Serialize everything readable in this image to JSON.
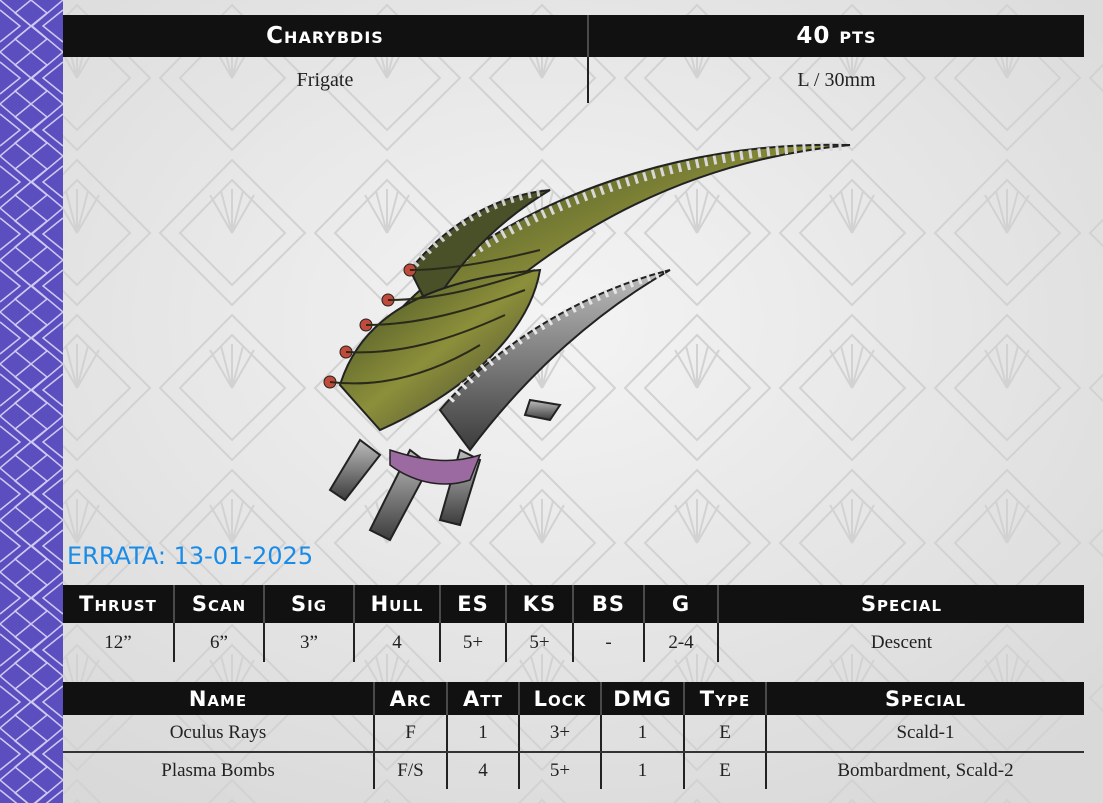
{
  "card": {
    "name": "Charybdis",
    "points": "40 pts",
    "class": "Frigate",
    "base": "L / 30mm"
  },
  "errata": "ERRATA: 13-01-2025",
  "stats": {
    "headers": [
      "Thrust",
      "Scan",
      "Sig",
      "Hull",
      "ES",
      "KS",
      "BS",
      "G",
      "Special"
    ],
    "values": [
      "12”",
      "6”",
      "3”",
      "4",
      "5+",
      "5+",
      "-",
      "2-4",
      "Descent"
    ]
  },
  "weapons": {
    "headers": [
      "Name",
      "Arc",
      "Att",
      "Lock",
      "DMG",
      "Type",
      "Special"
    ],
    "rows": [
      [
        "Oculus Rays",
        "F",
        "1",
        "3+",
        "1",
        "E",
        "Scald-1"
      ],
      [
        "Plasma Bombs",
        "F/S",
        "4",
        "5+",
        "1",
        "E",
        "Bombardment, Scald-2"
      ]
    ]
  },
  "colors": {
    "sidebar": "#5b4fbf",
    "header_bg": "#111111",
    "errata": "#1a8ce8"
  },
  "icons": {
    "ship_image": "alien-frigate-miniature"
  }
}
